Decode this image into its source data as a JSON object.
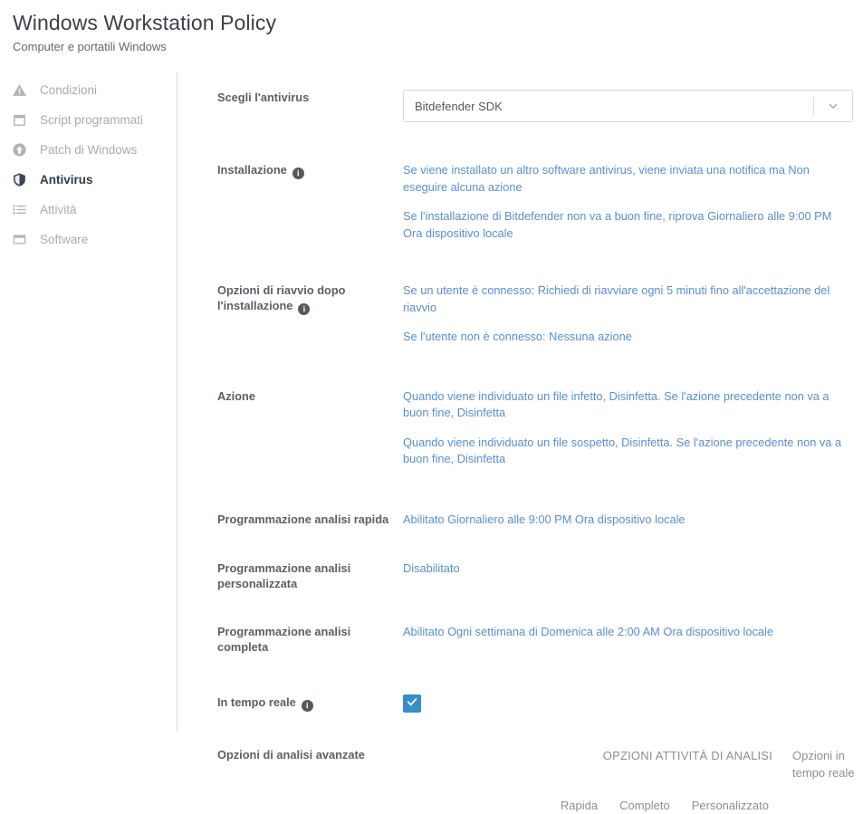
{
  "header": {
    "title": "Windows Workstation Policy",
    "subtitle": "Computer e portatili Windows"
  },
  "sidebar": {
    "items": [
      {
        "label": "Condizioni",
        "icon": "warning-triangle-icon",
        "active": false
      },
      {
        "label": "Script programmati",
        "icon": "calendar-icon",
        "active": false
      },
      {
        "label": "Patch di Windows",
        "icon": "arrow-up-circle-icon",
        "active": false
      },
      {
        "label": "Antivirus",
        "icon": "shield-icon",
        "active": true
      },
      {
        "label": "Attività",
        "icon": "list-icon",
        "active": false
      },
      {
        "label": "Software",
        "icon": "window-icon",
        "active": false
      }
    ]
  },
  "form": {
    "antivirus": {
      "label": "Scegli l'antivirus",
      "selected": "Bitdefender SDK",
      "arrow_icon": "chevron-down-icon"
    },
    "installation": {
      "label": "Installazione",
      "info_icon": "info-icon",
      "lines": [
        "Se viene installato un altro software antivirus, viene inviata una notifica ma Non eseguire alcuna azione",
        "Se l'installazione di Bitdefender non va a buon fine, riprova Giornaliero alle 9:00 PM Ora dispositivo locale"
      ]
    },
    "reboot": {
      "label": "Opzioni di riavvio dopo l'installazione",
      "info_icon": "info-icon",
      "lines": [
        "Se un utente è connesso: Richiedi di riavviare ogni 5 minuti fino all'accettazione del riavvio",
        "Se l'utente non è connesso: Nessuna azione"
      ]
    },
    "action": {
      "label": "Azione",
      "lines": [
        "Quando viene individuato un file infetto, Disinfetta. Se l'azione precedente non va a buon fine, Disinfetta",
        "Quando viene individuato un file sospetto, Disinfetta. Se l'azione precedente non va a buon fine, Disinfetta"
      ]
    },
    "quick_scan": {
      "label": "Programmazione analisi rapida",
      "value": "Abilitato Giornaliero alle 9:00 PM Ora dispositivo locale"
    },
    "custom_scan": {
      "label": "Programmazione analisi personalizzata",
      "value": "Disabilitato"
    },
    "full_scan": {
      "label": "Programmazione analisi completa",
      "value": "Abilitato Ogni settimana di Domenica alle 2:00 AM Ora dispositivo locale"
    },
    "realtime": {
      "label": "In tempo reale",
      "info_icon": "info-icon",
      "checked": true,
      "check_icon": "checkmark-icon"
    },
    "advanced": {
      "label": "Opzioni di analisi avanzate",
      "scan_tasks_title": "OPZIONI ATTIVITÀ DI ANALISI",
      "realtime_options_title": "Opzioni in tempo reale",
      "tabs": [
        {
          "label": "Rapida"
        },
        {
          "label": "Completo"
        },
        {
          "label": "Personalizzato"
        }
      ]
    }
  },
  "colors": {
    "link": "#5a8ed0",
    "checkbox": "#3a8dc8",
    "active_nav": "#333c49",
    "muted": "#a7abb1"
  }
}
